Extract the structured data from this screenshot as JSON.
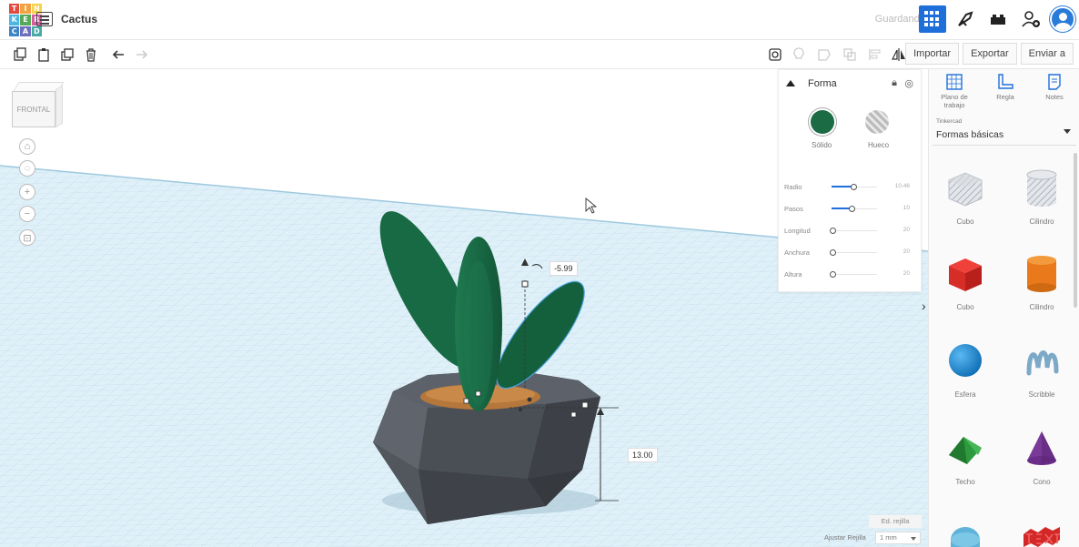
{
  "app": {
    "logo_letters": [
      "T",
      "I",
      "N",
      "K",
      "E",
      "R",
      "C",
      "A",
      "D"
    ],
    "project_title": "Cactus",
    "save_status": "Guardando..."
  },
  "toolbar": {
    "import_label": "Importar",
    "export_label": "Exportar",
    "send_label": "Enviar a"
  },
  "viewport": {
    "viewcube_label": "FRONTAL",
    "rotation_value": "-5.99",
    "height_value": "13.00"
  },
  "shape_panel": {
    "title": "Forma",
    "solid_label": "Sólido",
    "hole_label": "Hueco",
    "solid_color": "#1b6b45",
    "properties": [
      {
        "name": "Radio",
        "value": "10.46",
        "fraction": 0.48
      },
      {
        "name": "Pasos",
        "value": "10",
        "fraction": 0.45
      },
      {
        "name": "Longitud",
        "value": "20",
        "fraction": 0.0
      },
      {
        "name": "Anchura",
        "value": "20",
        "fraction": 0.0
      },
      {
        "name": "Altura",
        "value": "20",
        "fraction": 0.0
      }
    ]
  },
  "library": {
    "tools": [
      {
        "label": "Plano de trabajo",
        "icon": "workplane-icon"
      },
      {
        "label": "Regla",
        "icon": "ruler-icon"
      },
      {
        "label": "Notes",
        "icon": "notes-icon"
      }
    ],
    "category_small": "Tinkercad",
    "category": "Formas básicas",
    "items": [
      {
        "label": "Cubo",
        "icon": "box-hole-icon"
      },
      {
        "label": "Cilindro",
        "icon": "cylinder-hole-icon"
      },
      {
        "label": "Cubo",
        "icon": "box-icon"
      },
      {
        "label": "Cilindro",
        "icon": "cylinder-icon"
      },
      {
        "label": "Esfera",
        "icon": "sphere-icon"
      },
      {
        "label": "Scribble",
        "icon": "scribble-icon"
      },
      {
        "label": "Techo",
        "icon": "roof-icon"
      },
      {
        "label": "Cono",
        "icon": "cone-icon"
      }
    ]
  },
  "grid": {
    "edit_grid_label": "Ed. rejilla",
    "snap_label": "Ajustar Rejilla",
    "snap_value": "1 mm"
  },
  "colors": {
    "accent": "#1e6fd9",
    "pot": "#4a4e55",
    "cactus": "#1b6b45"
  }
}
